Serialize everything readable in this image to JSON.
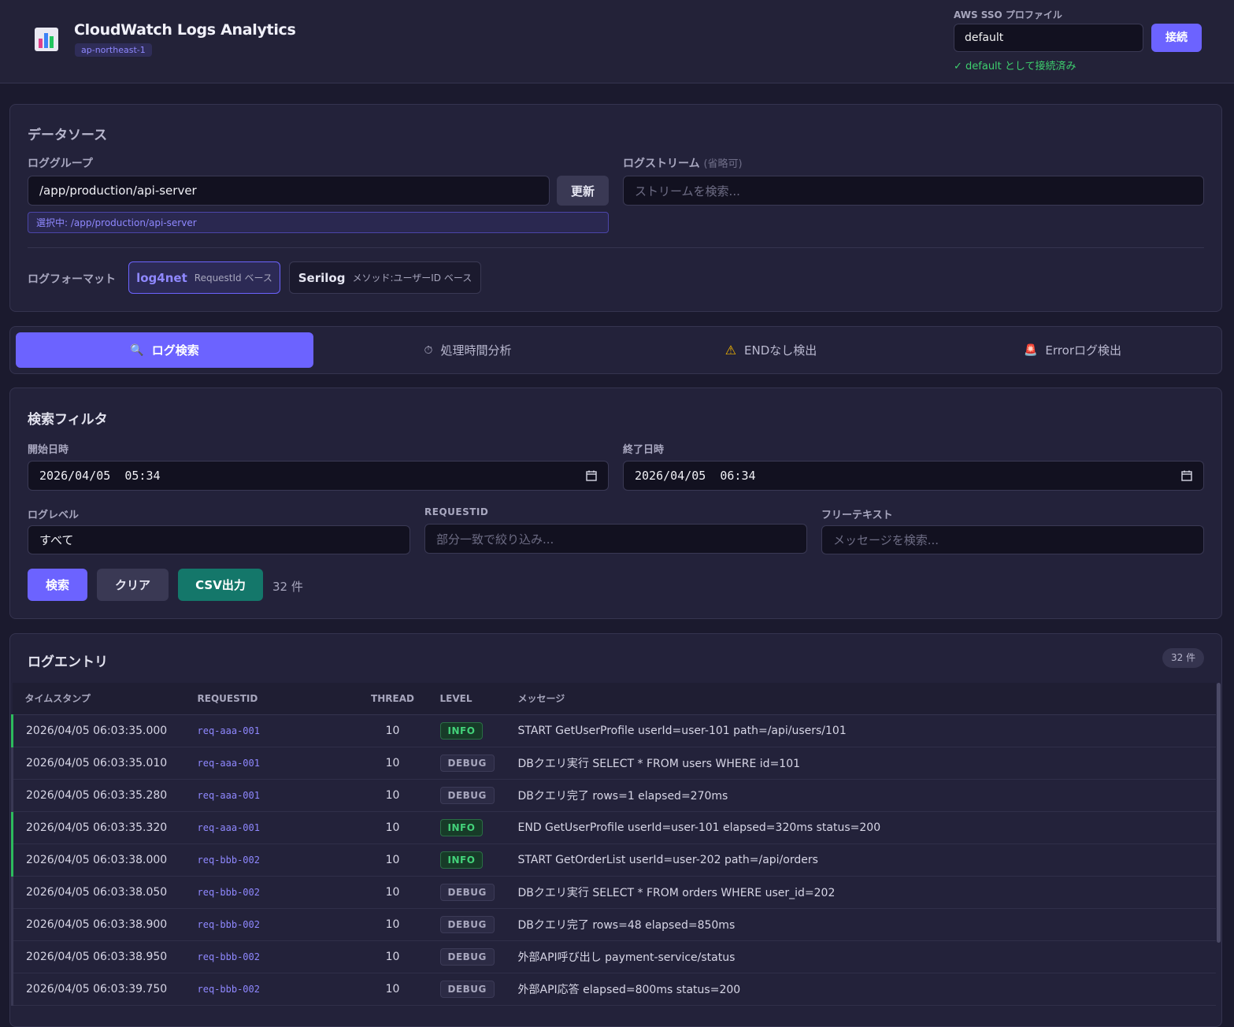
{
  "header": {
    "app_title": "CloudWatch Logs Analytics",
    "region": "ap-northeast-1",
    "sso_label": "AWS SSO プロファイル",
    "sso_profile_value": "default",
    "connect_label": "接続",
    "status_text": "✓ default として接続済み"
  },
  "datasource": {
    "title": "データソース",
    "log_group_label": "ロググループ",
    "log_group_value": "/app/production/api-server",
    "refresh_label": "更新",
    "selected_text": "選択中: /app/production/api-server",
    "log_stream_label": "ログストリーム",
    "log_stream_optional": "(省略可)",
    "log_stream_placeholder": "ストリームを検索...",
    "format_label": "ログフォーマット",
    "formats": [
      {
        "name": "log4net",
        "desc": "RequestId ベース"
      },
      {
        "name": "Serilog",
        "desc": "メソッド:ユーザーID ベース"
      }
    ]
  },
  "tabs": [
    {
      "icon": "🔍",
      "label": "ログ検索"
    },
    {
      "icon": "⏱",
      "label": "処理時間分析"
    },
    {
      "icon": "⚠",
      "label": "ENDなし検出"
    },
    {
      "icon": "🚨",
      "label": "Errorログ検出"
    }
  ],
  "filter": {
    "title": "検索フィルタ",
    "start_label": "開始日時",
    "start_value": "2026/04/05  05:34",
    "end_label": "終了日時",
    "end_value": "2026/04/05  06:34",
    "level_label": "ログレベル",
    "level_value": "すべて",
    "requestid_label": "REQUESTID",
    "requestid_placeholder": "部分一致で絞り込み...",
    "freetext_label": "フリーテキスト",
    "freetext_placeholder": "メッセージを検索...",
    "search_label": "検索",
    "clear_label": "クリア",
    "csv_label": "CSV出力",
    "count_text": "32 件"
  },
  "entries": {
    "title": "ログエントリ",
    "count_badge": "32 件",
    "columns": [
      "タイムスタンプ",
      "REQUESTID",
      "THREAD",
      "LEVEL",
      "メッセージ"
    ],
    "rows": [
      {
        "ts": "2026/04/05 06:03:35.000",
        "req": "req-aaa-001",
        "thread": "10",
        "level": "INFO",
        "msg": "START GetUserProfile userId=user-101 path=/api/users/101"
      },
      {
        "ts": "2026/04/05 06:03:35.010",
        "req": "req-aaa-001",
        "thread": "10",
        "level": "DEBUG",
        "msg": "DBクエリ実行 SELECT * FROM users WHERE id=101"
      },
      {
        "ts": "2026/04/05 06:03:35.280",
        "req": "req-aaa-001",
        "thread": "10",
        "level": "DEBUG",
        "msg": "DBクエリ完了 rows=1 elapsed=270ms"
      },
      {
        "ts": "2026/04/05 06:03:35.320",
        "req": "req-aaa-001",
        "thread": "10",
        "level": "INFO",
        "msg": "END GetUserProfile userId=user-101 elapsed=320ms status=200"
      },
      {
        "ts": "2026/04/05 06:03:38.000",
        "req": "req-bbb-002",
        "thread": "10",
        "level": "INFO",
        "msg": "START GetOrderList userId=user-202 path=/api/orders"
      },
      {
        "ts": "2026/04/05 06:03:38.050",
        "req": "req-bbb-002",
        "thread": "10",
        "level": "DEBUG",
        "msg": "DBクエリ実行 SELECT * FROM orders WHERE user_id=202"
      },
      {
        "ts": "2026/04/05 06:03:38.900",
        "req": "req-bbb-002",
        "thread": "10",
        "level": "DEBUG",
        "msg": "DBクエリ完了 rows=48 elapsed=850ms"
      },
      {
        "ts": "2026/04/05 06:03:38.950",
        "req": "req-bbb-002",
        "thread": "10",
        "level": "DEBUG",
        "msg": "外部API呼び出し payment-service/status"
      },
      {
        "ts": "2026/04/05 06:03:39.750",
        "req": "req-bbb-002",
        "thread": "10",
        "level": "DEBUG",
        "msg": "外部API応答 elapsed=800ms status=200"
      }
    ]
  },
  "colors": {
    "accent": "#6c63ff",
    "background": "#1b1a2e",
    "panel": "#23223a",
    "success": "#3ecf6e",
    "csv_button": "#14776a"
  }
}
